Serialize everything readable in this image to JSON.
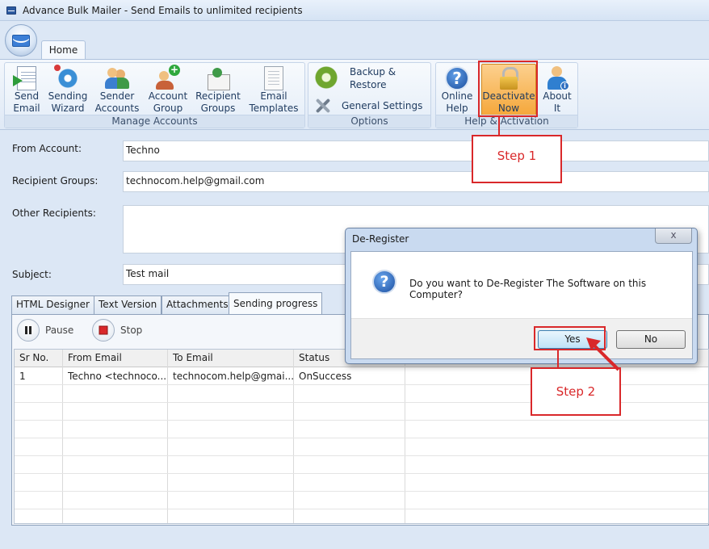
{
  "window": {
    "title": "Advance Bulk Mailer - Send Emails to unlimited recipients"
  },
  "ribbon": {
    "tab_home": "Home",
    "groups": {
      "manage": {
        "label": "Manage Accounts",
        "buttons": [
          {
            "l1": "Send",
            "l2": "Email",
            "icon": "send-email-icon"
          },
          {
            "l1": "Sending",
            "l2": "Wizard",
            "icon": "wizard-icon"
          },
          {
            "l1": "Sender",
            "l2": "Accounts",
            "icon": "sender-accounts-icon"
          },
          {
            "l1": "Account",
            "l2": "Group",
            "icon": "account-group-icon"
          },
          {
            "l1": "Recipient",
            "l2": "Groups",
            "icon": "recipient-groups-icon"
          },
          {
            "l1": "Email",
            "l2": "Templates",
            "icon": "email-templates-icon"
          }
        ]
      },
      "options": {
        "label": "Options",
        "backup_l1": "Backup &",
        "backup_l2": "Restore",
        "general_settings": "General Settings"
      },
      "help": {
        "label": "Help & Activation",
        "buttons": [
          {
            "l1": "Online",
            "l2": "Help",
            "icon": "help-icon"
          },
          {
            "l1": "Deactivate",
            "l2": "Now",
            "icon": "lock-icon"
          },
          {
            "l1": "About",
            "l2": "It",
            "icon": "about-icon"
          }
        ]
      }
    }
  },
  "form": {
    "from_label": "From Account:",
    "from_value": "Techno",
    "recipient_groups_label": "Recipient Groups:",
    "recipient_groups_value": "technocom.help@gmail.com",
    "other_recipients_label": "Other Recipients:",
    "other_recipients_value": "",
    "subject_label": "Subject:",
    "subject_value": "Test mail"
  },
  "tabs": [
    "HTML Designer",
    "Text Version",
    "Attachments",
    "Sending progress"
  ],
  "active_tab": "Sending progress",
  "controls": {
    "pause": "Pause",
    "stop": "Stop"
  },
  "grid": {
    "headers": [
      "Sr No.",
      "From Email",
      "To Email",
      "Status"
    ],
    "rows": [
      [
        "1",
        "Techno <technoco...",
        "technocom.help@gmai...",
        "OnSuccess"
      ]
    ]
  },
  "dialog": {
    "title": "De-Register",
    "close": "x",
    "message": "Do you want to De-Register The Software on this Computer?",
    "yes": "Yes",
    "no": "No"
  },
  "annotations": {
    "step1": "Step 1",
    "step2": "Step 2",
    "color": "#d9282a"
  }
}
